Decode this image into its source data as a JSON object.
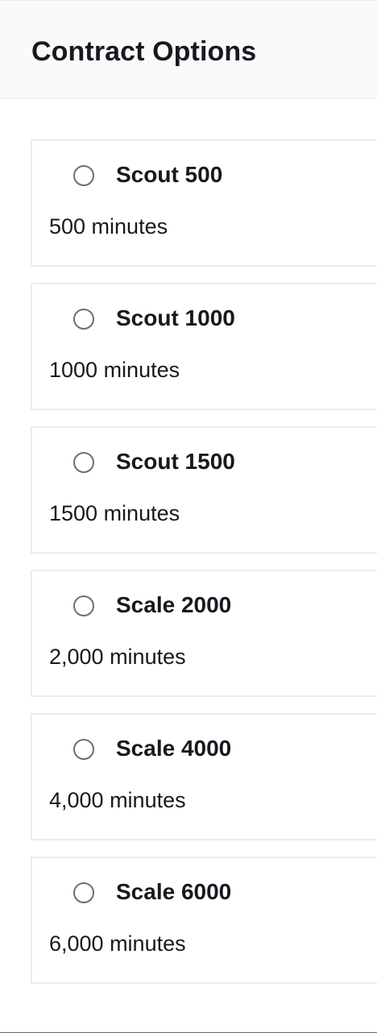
{
  "panel": {
    "title": "Contract Options"
  },
  "options": [
    {
      "name": "Scout 500",
      "description": "500 minutes",
      "selected": false
    },
    {
      "name": "Scout 1000",
      "description": "1000 minutes",
      "selected": false
    },
    {
      "name": "Scout 1500",
      "description": "1500 minutes",
      "selected": false
    },
    {
      "name": "Scale 2000",
      "description": "2,000 minutes",
      "selected": false
    },
    {
      "name": "Scale 4000",
      "description": "4,000 minutes",
      "selected": false
    },
    {
      "name": "Scale 6000",
      "description": "6,000 minutes",
      "selected": false
    }
  ],
  "colors": {
    "header_background": "#fafafa",
    "card_border": "#eaeded",
    "radio_border": "#687078",
    "text": "#16191f"
  }
}
